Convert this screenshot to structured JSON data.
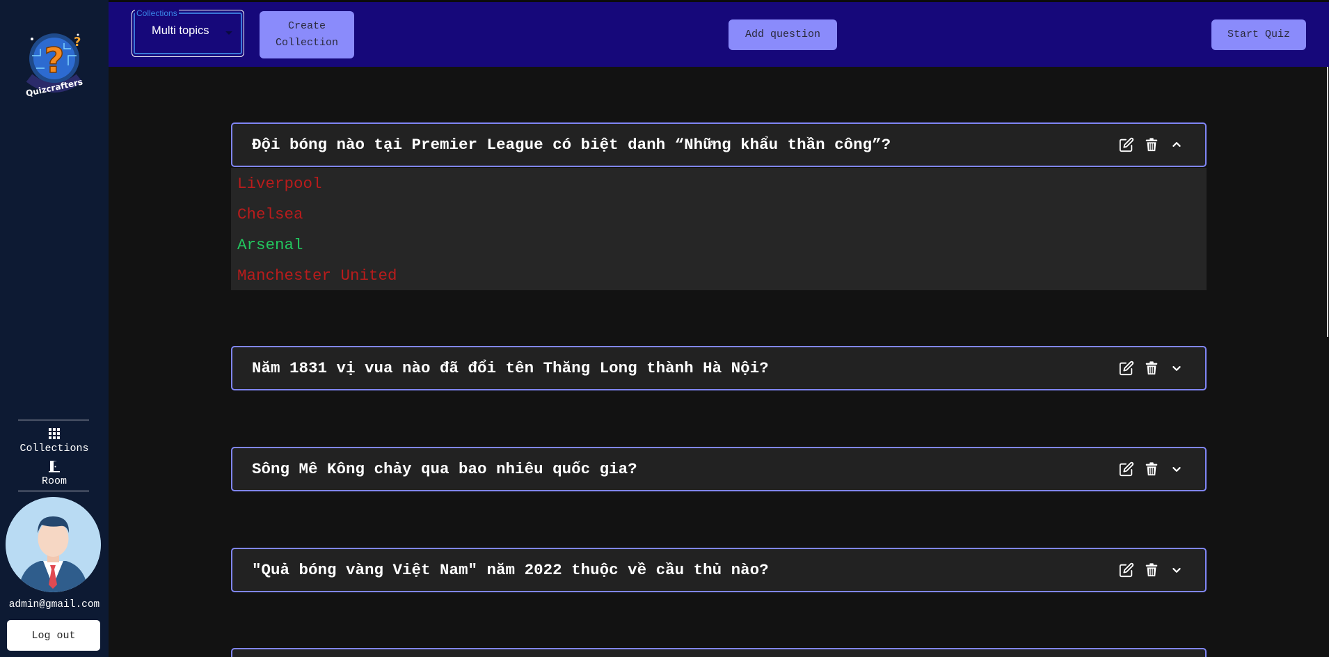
{
  "sidebar": {
    "logo_text": "Quizcrafters",
    "nav": [
      {
        "label": "Collections",
        "icon": "grid-icon"
      },
      {
        "label": "Room",
        "icon": "door-icon"
      }
    ],
    "user_email": "admin@gmail.com",
    "logout_label": "Log out"
  },
  "topbar": {
    "collections_legend": "Collections",
    "collections_value": "Multi topics",
    "create_collection_line1": "Create",
    "create_collection_line2": "Collection",
    "add_question_label": "Add question",
    "start_quiz_label": "Start Quiz"
  },
  "colors": {
    "topbar_bg": "#16087a",
    "button_bg": "#8a8bfb",
    "card_border": "#8086f6",
    "correct_answer": "#22c55e",
    "wrong_answer": "#b91c1c"
  },
  "questions": [
    {
      "text": "Đội bóng nào tại Premier League có biệt danh “Những khẩu thần công”?",
      "expanded": true,
      "answers": [
        {
          "text": "Liverpool",
          "correct": false
        },
        {
          "text": "Chelsea",
          "correct": false
        },
        {
          "text": "Arsenal",
          "correct": true
        },
        {
          "text": "Manchester United",
          "correct": false
        }
      ]
    },
    {
      "text": "Năm 1831 vị vua nào đã đổi tên Thăng Long thành Hà Nội?",
      "expanded": false
    },
    {
      "text": "Sông Mê Kông chảy qua bao nhiêu quốc gia?",
      "expanded": false
    },
    {
      "text": "\"Quả bóng vàng Việt Nam\" năm 2022 thuộc về cầu thủ nào?",
      "expanded": false
    },
    {
      "text": "",
      "expanded": false
    }
  ]
}
